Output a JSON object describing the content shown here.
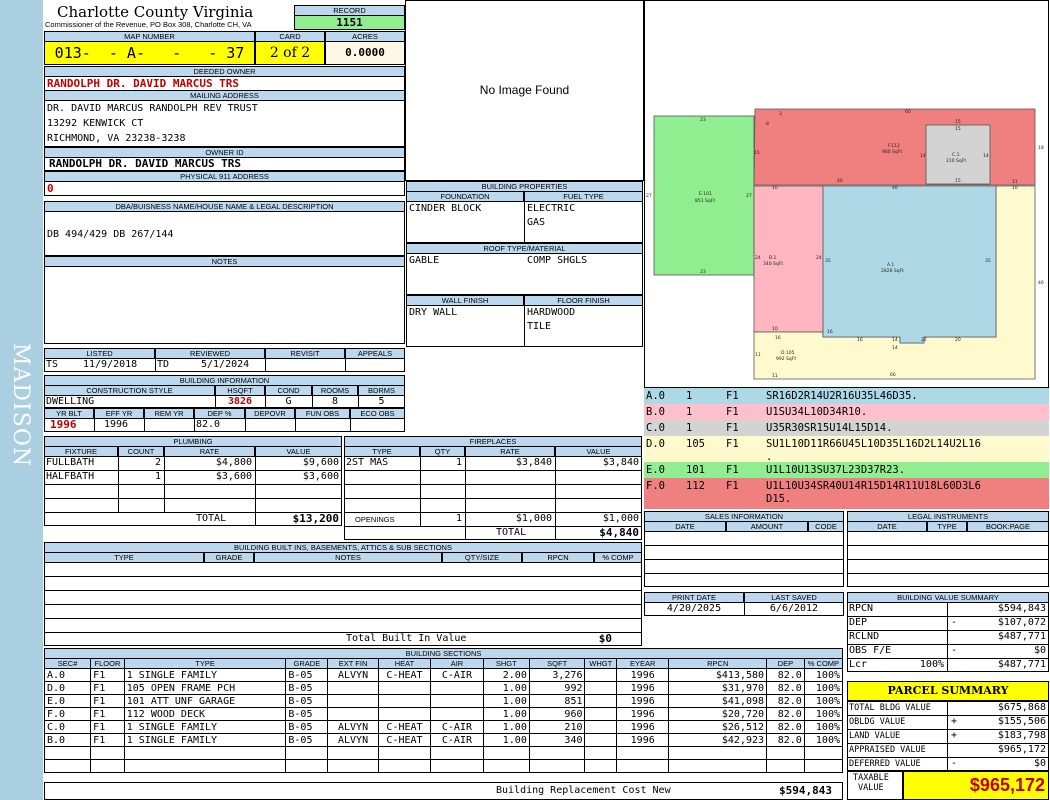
{
  "side": {
    "district": "MADISON"
  },
  "header": {
    "county": "Charlotte County Virginia",
    "office": "Commissioner of the Revenue, PO Box 308, Charlotte CH, VA",
    "record_label": "RECORD",
    "record": "1151",
    "map_label": "MAP NUMBER",
    "map_number": "013-  - A-   -   - 37",
    "card_label": "CARD",
    "card": "2 of 2",
    "acres_label": "ACRES",
    "acres": "0.0000"
  },
  "owner": {
    "deeded_label": "DEEDED OWNER",
    "deeded": "RANDOLPH DR. DAVID MARCUS TRS",
    "mailing_label": "MAILING ADDRESS",
    "mailing": [
      "DR. DAVID MARCUS RANDOLPH REV TRUST",
      "13292 KENWICK CT",
      "RICHMOND, VA 23238-3238"
    ],
    "id_label": "OWNER ID",
    "id": "RANDOLPH DR. DAVID MARCUS TRS",
    "phys_label": "PHYSICAL 911 ADDRESS",
    "phys": "0"
  },
  "dba": {
    "label": "DBA/BUISNESS NAME/HOUSE NAME & LEGAL DESCRIPTION",
    "text": "DB 494/429 DB 267/144"
  },
  "notes": {
    "label": "NOTES"
  },
  "image": {
    "text": "No Image Found"
  },
  "dates": {
    "listed_label": "LISTED",
    "reviewed_label": "REVIEWED",
    "revisit_label": "REVISIT",
    "appeals_label": "APPEALS",
    "listed_by": "TS",
    "listed": "11/9/2018",
    "reviewed_by": "TD",
    "reviewed": "5/1/2024"
  },
  "building_info": {
    "label": "BUILDING INFORMATION",
    "cs_label": "CONSTRUCTION STYLE",
    "hsqft_label": "HSQFT",
    "cond_label": "COND",
    "rooms_label": "ROOMS",
    "bdrms_label": "BDRMS",
    "style": "DWELLING",
    "hsqft": "3826",
    "cond": "G",
    "rooms": "8",
    "bdrms": "5",
    "yrblt_label": "YR BLT",
    "effyr_label": "EFF YR",
    "remyr_label": "REM YR",
    "dep_label": "DEP %",
    "depovr_label": "DEPOVR",
    "funobs_label": "FUN OBS",
    "ecoobs_label": "ECO OBS",
    "yrblt": "1996",
    "effyr": "1996",
    "dep": "82.0"
  },
  "building_props": {
    "label": "BUILDING PROPERTIES",
    "foundation_label": "FOUNDATION",
    "fuel_label": "FUEL TYPE",
    "foundation": "CINDER BLOCK",
    "fuel1": "ELECTRIC",
    "fuel2": "GAS",
    "roof_label": "ROOF TYPE/MATERIAL",
    "roof_type": "GABLE",
    "roof_mat": "COMP SHGLS",
    "wall_label": "WALL FINISH",
    "floor_label": "FLOOR FINISH",
    "wall": "DRY WALL",
    "floor1": "HARDWOOD",
    "floor2": "TILE"
  },
  "plumbing": {
    "label": "PLUMBING",
    "cols": [
      "FIXTURE",
      "COUNT",
      "RATE",
      "VALUE"
    ],
    "rows": [
      [
        "FULLBATH",
        "2",
        "$4,800",
        "$9,600"
      ],
      [
        "HALFBATH",
        "1",
        "$3,600",
        "$3,600"
      ]
    ],
    "total_label": "TOTAL",
    "total": "$13,200"
  },
  "fireplaces": {
    "label": "FIREPLACES",
    "cols": [
      "TYPE",
      "QTY",
      "RATE",
      "VALUE"
    ],
    "rows": [
      [
        "2ST MAS",
        "1",
        "$3,840",
        "$3,840"
      ]
    ],
    "openings_label": "OPENINGS",
    "openings": [
      "1",
      "$1,000",
      "$1,000"
    ],
    "total_label": "TOTAL",
    "total": "$4,840"
  },
  "builtins": {
    "label": "BUILDING BUILT INS, BASEMENTS, ATTICS & SUB SECTIONS",
    "cols": [
      "TYPE",
      "GRADE",
      "NOTES",
      "QTY/SIZE",
      "RPCN",
      "% COMP"
    ],
    "total_label": "Total Built In Value",
    "total": "$0"
  },
  "sections": {
    "label": "BUILDING SECTIONS",
    "cols": [
      "SEC#",
      "FLOOR",
      "TYPE",
      "GRADE",
      "EXT FIN",
      "HEAT",
      "AIR",
      "SHGT",
      "SQFT",
      "WHGT",
      "EYEAR",
      "RPCN",
      "DEP",
      "% COMP"
    ],
    "rows": [
      [
        "A.0",
        "F1",
        "1 SINGLE FAMILY",
        "B-05",
        "ALVYN",
        "C-HEAT",
        "C-AIR",
        "2.00",
        "3,276",
        "",
        "1996",
        "$413,580",
        "82.0",
        "100%"
      ],
      [
        "D.0",
        "F1",
        "105 OPEN FRAME PCH",
        "B-05",
        "",
        "",
        "",
        "1.00",
        "992",
        "",
        "1996",
        "$31,970",
        "82.0",
        "100%"
      ],
      [
        "E.0",
        "F1",
        "101 ATT UNF GARAGE",
        "B-05",
        "",
        "",
        "",
        "1.00",
        "851",
        "",
        "1996",
        "$41,098",
        "82.0",
        "100%"
      ],
      [
        "F.0",
        "F1",
        "112 WOOD DECK",
        "B-05",
        "",
        "",
        "",
        "1.00",
        "960",
        "",
        "1996",
        "$20,720",
        "82.0",
        "100%"
      ],
      [
        "C.0",
        "F1",
        "1 SINGLE FAMILY",
        "B-05",
        "ALVYN",
        "C-HEAT",
        "C-AIR",
        "1.00",
        "210",
        "",
        "1996",
        "$26,512",
        "82.0",
        "100%"
      ],
      [
        "B.0",
        "F1",
        "1 SINGLE FAMILY",
        "B-05",
        "ALVYN",
        "C-HEAT",
        "C-AIR",
        "1.00",
        "340",
        "",
        "1996",
        "$42,923",
        "82.0",
        "100%"
      ]
    ],
    "rcn_label": "Building Replacement Cost New",
    "rcn": "$594,843"
  },
  "sketch": {
    "areas": [
      {
        "id": "A.1",
        "sqft": "2826 SqFt",
        "color": "#aed8e6"
      },
      {
        "id": "B.1",
        "sqft": "340 SqFt",
        "color": "#ffb6c1"
      },
      {
        "id": "C.1",
        "sqft": "210 SqFt",
        "color": "#d3d3d3"
      },
      {
        "id": "D.105",
        "sqft": "992 SqFt",
        "color": "#fffacd"
      },
      {
        "id": "E.101",
        "sqft": "851 SqFt",
        "color": "#90ee90"
      },
      {
        "id": "F.112",
        "sqft": "960 SqFt",
        "color": "#f08080"
      }
    ],
    "dims": [
      "23",
      "27",
      "27",
      "23",
      "60",
      "15",
      "15",
      "18",
      "14",
      "14",
      "15",
      "15",
      "40",
      "46",
      "11",
      "10",
      "10",
      "24",
      "24",
      "35",
      "35",
      "46",
      "10",
      "16",
      "16",
      "20",
      "22",
      "14",
      "14",
      "16",
      "11",
      "11",
      "66",
      "8",
      "3"
    ]
  },
  "segments": [
    {
      "sec": "A.0",
      "qty": "1",
      "floor": "F1",
      "code": "SR16D2R14U2R16U35L46D35.",
      "color": "#add8e6"
    },
    {
      "sec": "B.0",
      "qty": "1",
      "floor": "F1",
      "code": "U1SU34L10D34R10.",
      "color": "#ffc0cb"
    },
    {
      "sec": "C.0",
      "qty": "1",
      "floor": "F1",
      "code": "U35R30SR15U14L15D14.",
      "color": "#d3d3d3"
    },
    {
      "sec": "D.0",
      "qty": "105",
      "floor": "F1",
      "code": "SU1L10D11R66U45L10D35L16D2L14U2L16",
      "code2": ".",
      "color": "#fffacd"
    },
    {
      "sec": "E.0",
      "qty": "101",
      "floor": "F1",
      "code": "U1L10U13SU37L23D37R23.",
      "color": "#90ee90"
    },
    {
      "sec": "F.0",
      "qty": "112",
      "floor": "F1",
      "code": "U1L10U34SR40U14R15D14R11U18L60D3L6",
      "code2": "D15.",
      "color": "#f08080"
    }
  ],
  "sales": {
    "label": "SALES INFORMATION",
    "cols": [
      "DATE",
      "AMOUNT",
      "CODE"
    ]
  },
  "legal": {
    "label": "LEGAL INSTRUMENTS",
    "cols": [
      "DATE",
      "TYPE",
      "BOOK:PAGE"
    ]
  },
  "print": {
    "print_label": "PRINT DATE",
    "saved_label": "LAST SAVED",
    "print_date": "4/20/2025",
    "saved_date": "6/6/2012"
  },
  "value_summary": {
    "label": "BUILDING VALUE SUMMARY",
    "rows": [
      {
        "k": "RPCN",
        "s": "",
        "v": "$594,843"
      },
      {
        "k": "DEP",
        "s": "-",
        "v": "$107,072"
      },
      {
        "k": "RCLND",
        "s": "",
        "v": "$487,771"
      },
      {
        "k": "OBS F/E",
        "s": "-",
        "v": "$0"
      },
      {
        "k": "Lcr",
        "p": "100%",
        "s": "",
        "v": "$487,771"
      }
    ]
  },
  "parcel": {
    "label": "PARCEL SUMMARY",
    "rows": [
      {
        "k": "TOTAL BLDG VALUE",
        "s": "",
        "v": "$675,868"
      },
      {
        "k": "OBLDG VALUE",
        "s": "+",
        "v": "$155,506"
      },
      {
        "k": "LAND VALUE",
        "s": "+",
        "v": "$183,798"
      },
      {
        "k": "APPRAISED VALUE",
        "s": "",
        "v": "$965,172"
      },
      {
        "k": "DEFERRED VALUE",
        "s": "-",
        "v": "$0"
      }
    ],
    "taxable_label1": "TAXABLE",
    "taxable_label2": "VALUE",
    "taxable": "$965,172"
  },
  "colors": {
    "header": "#bcd8ee",
    "yellow": "#ffff00",
    "green": "#90ee90",
    "side": "#a9cfe0",
    "red": "#c00000"
  }
}
